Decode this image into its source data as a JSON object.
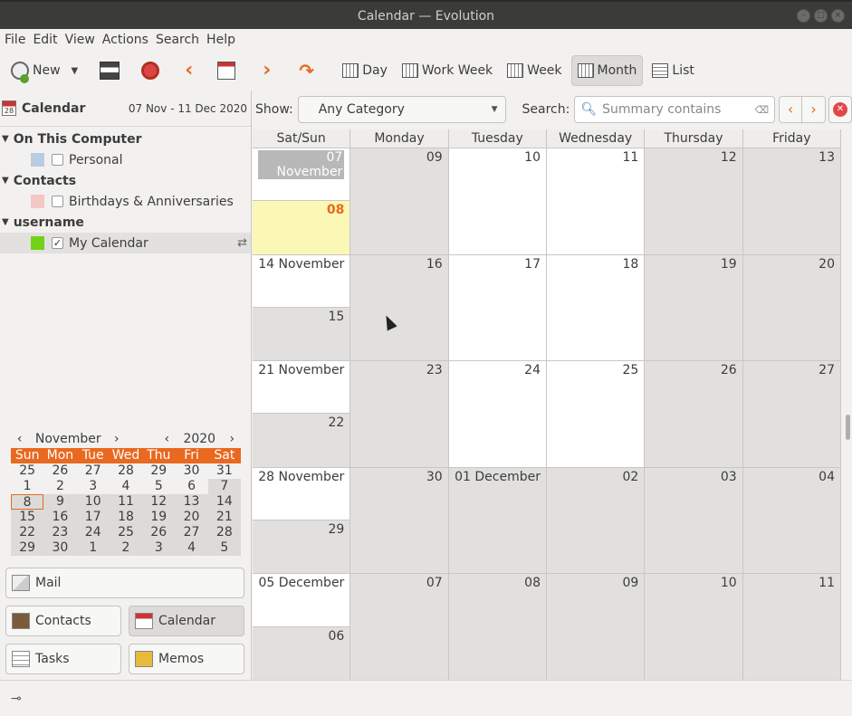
{
  "window": {
    "title": "Calendar — Evolution"
  },
  "menu": [
    "File",
    "Edit",
    "View",
    "Actions",
    "Search",
    "Help"
  ],
  "toolbar": {
    "new_label": "New",
    "views": [
      {
        "label": "Day",
        "active": false
      },
      {
        "label": "Work Week",
        "active": false
      },
      {
        "label": "Week",
        "active": false
      },
      {
        "label": "Month",
        "active": true
      },
      {
        "label": "List",
        "active": false
      }
    ]
  },
  "left": {
    "title": "Calendar",
    "range": "07 Nov - 11 Dec 2020",
    "groups": [
      {
        "name": "On This Computer",
        "sources": [
          {
            "name": "Personal",
            "color": "#b9cce4",
            "checked": false
          }
        ]
      },
      {
        "name": "Contacts",
        "sources": [
          {
            "name": "Birthdays & Anniversaries",
            "color": "#f5c6c6",
            "checked": false
          }
        ]
      },
      {
        "name": "username",
        "sources": [
          {
            "name": "My Calendar",
            "color": "#73d216",
            "checked": true
          }
        ]
      }
    ]
  },
  "mini_calendar": {
    "month": "November",
    "year": "2020",
    "dow": [
      "Sun",
      "Mon",
      "Tue",
      "Wed",
      "Thu",
      "Fri",
      "Sat"
    ],
    "weeks": [
      [
        "25",
        "26",
        "27",
        "28",
        "29",
        "30",
        "31"
      ],
      [
        "1",
        "2",
        "3",
        "4",
        "5",
        "6",
        "7"
      ],
      [
        "8",
        "9",
        "10",
        "11",
        "12",
        "13",
        "14"
      ],
      [
        "15",
        "16",
        "17",
        "18",
        "19",
        "20",
        "21"
      ],
      [
        "22",
        "23",
        "24",
        "25",
        "26",
        "27",
        "28"
      ],
      [
        "29",
        "30",
        "1",
        "2",
        "3",
        "4",
        "5"
      ]
    ],
    "today": "8"
  },
  "switcher": {
    "mail": "Mail",
    "contacts": "Contacts",
    "calendar": "Calendar",
    "tasks": "Tasks",
    "memos": "Memos"
  },
  "filter": {
    "show_label": "Show:",
    "category": "Any Category",
    "search_label": "Search:",
    "search_placeholder": "Summary contains"
  },
  "month_view": {
    "headers": [
      "Sat/Sun",
      "Monday",
      "Tuesday",
      "Wednesday",
      "Thursday",
      "Friday"
    ],
    "weeks": [
      {
        "sat": "07 November",
        "sun": "08",
        "days": [
          "09",
          "10",
          "11",
          "12",
          "13"
        ],
        "shades": [
          "grey",
          "white",
          "white",
          "grey",
          "grey"
        ]
      },
      {
        "sat": "14 November",
        "sun": "15",
        "days": [
          "16",
          "17",
          "18",
          "19",
          "20"
        ],
        "shades": [
          "grey",
          "white",
          "white",
          "grey",
          "grey"
        ]
      },
      {
        "sat": "21 November",
        "sun": "22",
        "days": [
          "23",
          "24",
          "25",
          "26",
          "27"
        ],
        "shades": [
          "grey",
          "white",
          "white",
          "grey",
          "grey"
        ]
      },
      {
        "sat": "28 November",
        "sun": "29",
        "days": [
          "30",
          "01 December",
          "02",
          "03",
          "04"
        ],
        "shades": [
          "grey",
          "grey",
          "grey",
          "grey",
          "grey"
        ]
      },
      {
        "sat": "05 December",
        "sun": "06",
        "days": [
          "07",
          "08",
          "09",
          "10",
          "11"
        ],
        "shades": [
          "grey",
          "grey",
          "grey",
          "grey",
          "grey"
        ]
      }
    ]
  }
}
